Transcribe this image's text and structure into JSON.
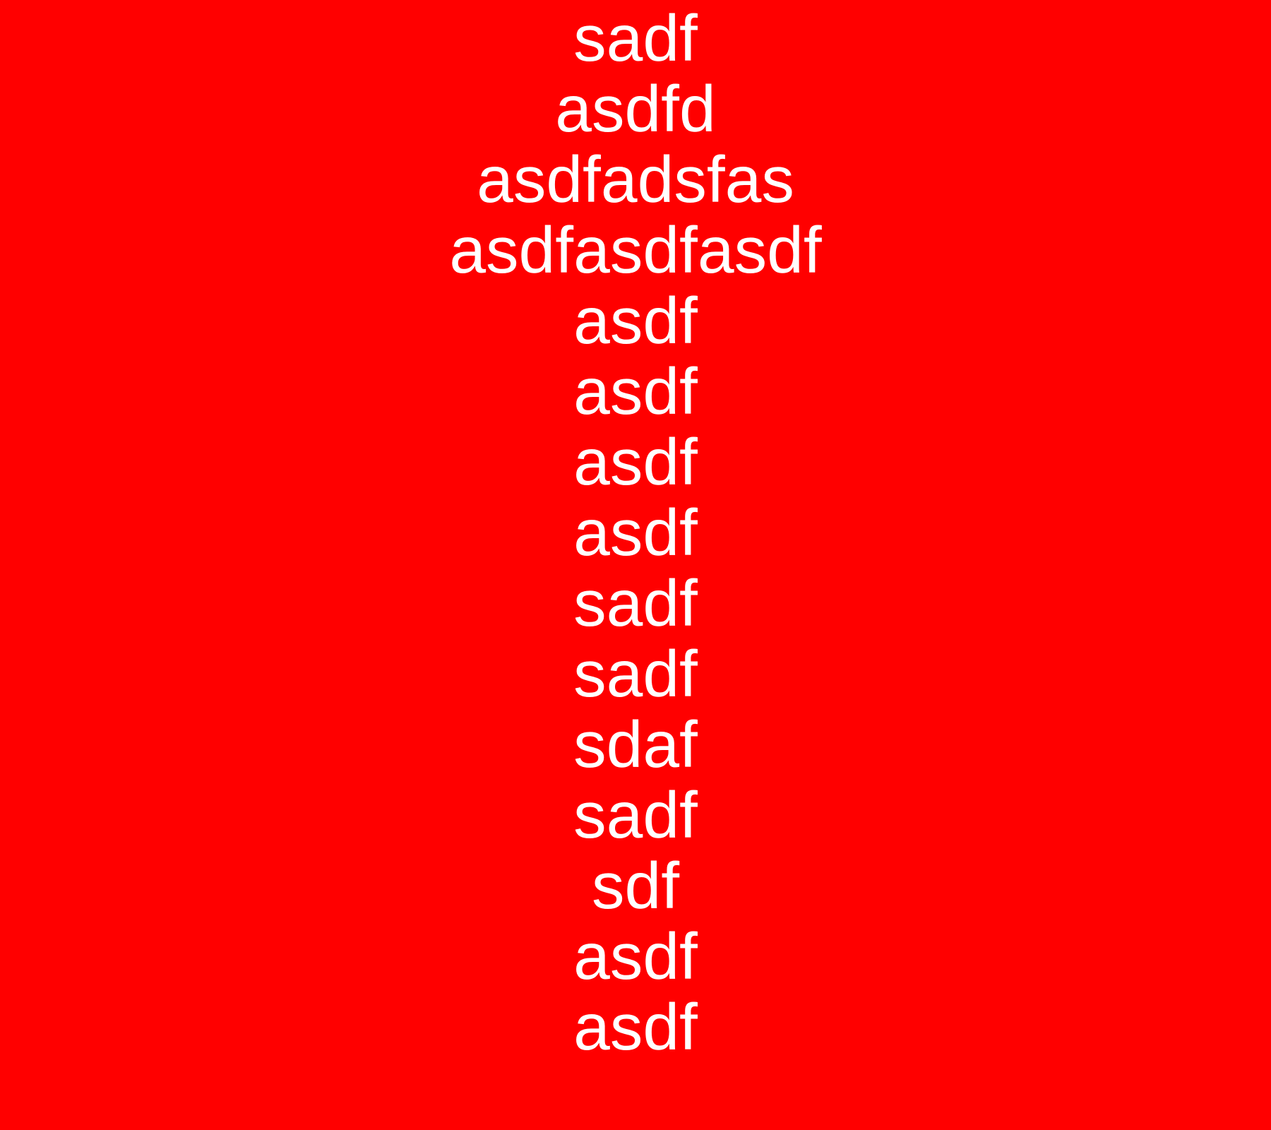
{
  "background_color": "#ff0000",
  "text_color": "#ffffff",
  "lines": [
    "sadf",
    "asdfd",
    "asdfadsfas",
    "asdfasdfasdf",
    "asdf",
    "asdf",
    "asdf",
    "asdf",
    "sadf",
    "sadf",
    "sdaf",
    "sadf",
    "sdf",
    "asdf",
    "asdf"
  ]
}
